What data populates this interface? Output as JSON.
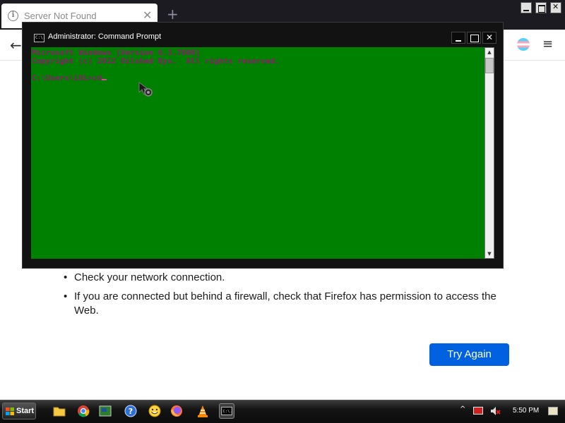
{
  "browser": {
    "tab": {
      "title": "Server Not Found",
      "close_glyph": "✕",
      "icon": "info-icon"
    },
    "new_tab_glyph": "+",
    "back_glyph": "←",
    "menu_glyph": "≡"
  },
  "page": {
    "suggestions": [
      "Check your network connection.",
      "If you are connected but behind a firewall, check that Firefox has permission to access the Web."
    ],
    "try_again_label": "Try Again"
  },
  "cmd": {
    "title": "Administrator: Command Prompt",
    "icon_text": "C:\\.",
    "lines": [
      "Microsoft Windows [Version 6.3.7600]",
      "Copyright (c) 2012 Oilshed Rys.  All rights reserved.",
      "",
      "C:\\Users\\LOL>cd"
    ],
    "colors": {
      "background": "#008000",
      "text": "#8b1e6b"
    }
  },
  "taskbar": {
    "start_label": "Start",
    "clock": "5:50 PM",
    "pinned_icons": [
      "folder-icon",
      "chrome-icon",
      "network-app-icon",
      "help-icon",
      "smiley-icon",
      "firefox-icon",
      "vlc-icon",
      "cmd-taskbar-icon"
    ]
  },
  "colors": {
    "accent": "#0061e0",
    "tabstrip": "#1c1b22",
    "taskbar": "#0c0c0c"
  }
}
